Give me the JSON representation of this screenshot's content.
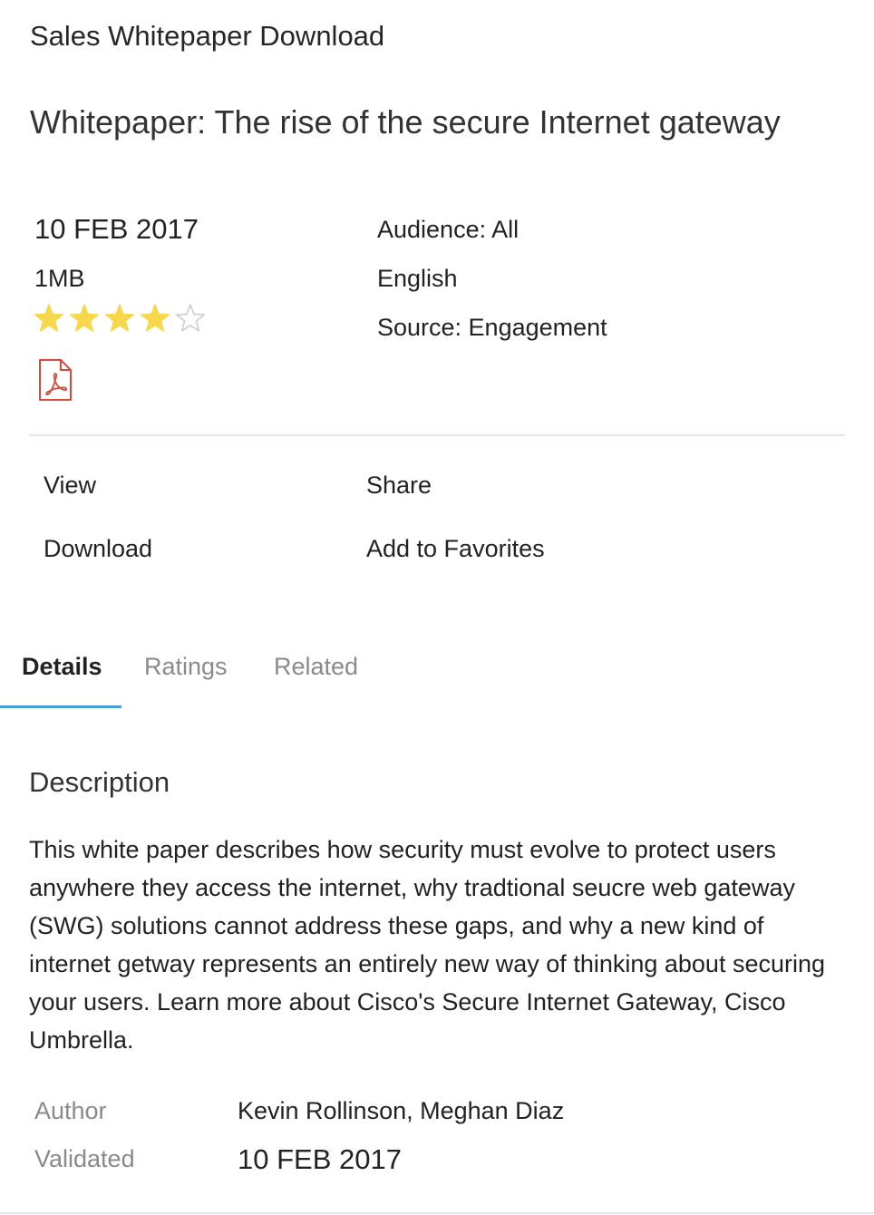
{
  "header": {
    "page_heading": "Sales Whitepaper Download",
    "title": "Whitepaper: The rise of the secure Internet gateway"
  },
  "meta": {
    "date": "10 FEB 2017",
    "size": "1MB",
    "rating": 4,
    "rating_max": 5,
    "file_type_icon": "pdf-file-icon",
    "audience": "Audience: All",
    "language": "English",
    "source": "Source: Engagement"
  },
  "actions": {
    "view": "View",
    "share": "Share",
    "download": "Download",
    "favorites": "Add to Favorites"
  },
  "tabs": [
    {
      "label": "Details",
      "active": true
    },
    {
      "label": "Ratings",
      "active": false
    },
    {
      "label": "Related",
      "active": false
    }
  ],
  "details": {
    "description_heading": "Description",
    "description": "This white paper describes how security must evolve to protect users anywhere they access the internet, why tradtional seucre web gateway (SWG) solutions cannot address these gaps, and why a new kind of internet getway represents an entirely new way of thinking about securing your users. Learn more about Cisco's Secure Internet Gateway, Cisco Umbrella.",
    "author_label": "Author",
    "author_value": "Kevin Rollinson, Meghan Diaz",
    "validated_label": "Validated",
    "validated_value": "10 FEB 2017"
  },
  "colors": {
    "star_filled": "#f7d84a",
    "star_empty": "#c8c8c8",
    "pdf_red": "#d9483b",
    "tab_accent": "#4a9fd8",
    "muted_text": "#8a8a8a"
  }
}
